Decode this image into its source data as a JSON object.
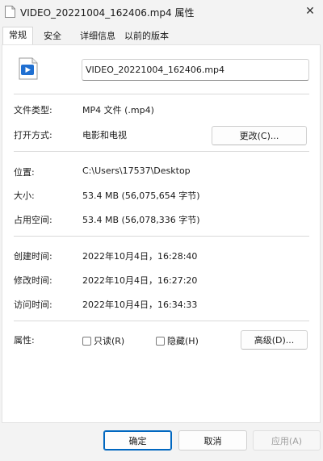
{
  "window": {
    "title": "VIDEO_20221004_162406.mp4 属性",
    "close_glyph": "✕"
  },
  "tabs": [
    {
      "label": "常规",
      "active": true
    },
    {
      "label": "安全",
      "active": false
    },
    {
      "label": "详细信息",
      "active": false
    },
    {
      "label": "以前的版本",
      "active": false
    }
  ],
  "file": {
    "name": "VIDEO_20221004_162406.mp4",
    "icon": "video-file-icon"
  },
  "info": {
    "file_type_label": "文件类型:",
    "file_type_value": "MP4 文件 (.mp4)",
    "opens_with_label": "打开方式:",
    "opens_with_value": "电影和电视",
    "change_button": "更改(C)...",
    "location_label": "位置:",
    "location_value": "C:\\Users\\17537\\Desktop",
    "size_label": "大小:",
    "size_value": "53.4 MB (56,075,654 字节)",
    "size_on_disk_label": "占用空间:",
    "size_on_disk_value": "53.4 MB (56,078,336 字节)",
    "created_label": "创建时间:",
    "created_value": "2022年10月4日，16:28:40",
    "modified_label": "修改时间:",
    "modified_value": "2022年10月4日，16:27:20",
    "accessed_label": "访问时间:",
    "accessed_value": "2022年10月4日，16:34:33",
    "attributes_label": "属性:",
    "readonly_label": "只读(R)",
    "readonly_checked": false,
    "hidden_label": "隐藏(H)",
    "hidden_checked": false,
    "advanced_button": "高级(D)..."
  },
  "buttons": {
    "ok": "确定",
    "cancel": "取消",
    "apply": "应用(A)"
  },
  "colors": {
    "accent": "#0067c0",
    "disabled_text": "#a0a0a0",
    "separator": "#d9d9d9"
  }
}
